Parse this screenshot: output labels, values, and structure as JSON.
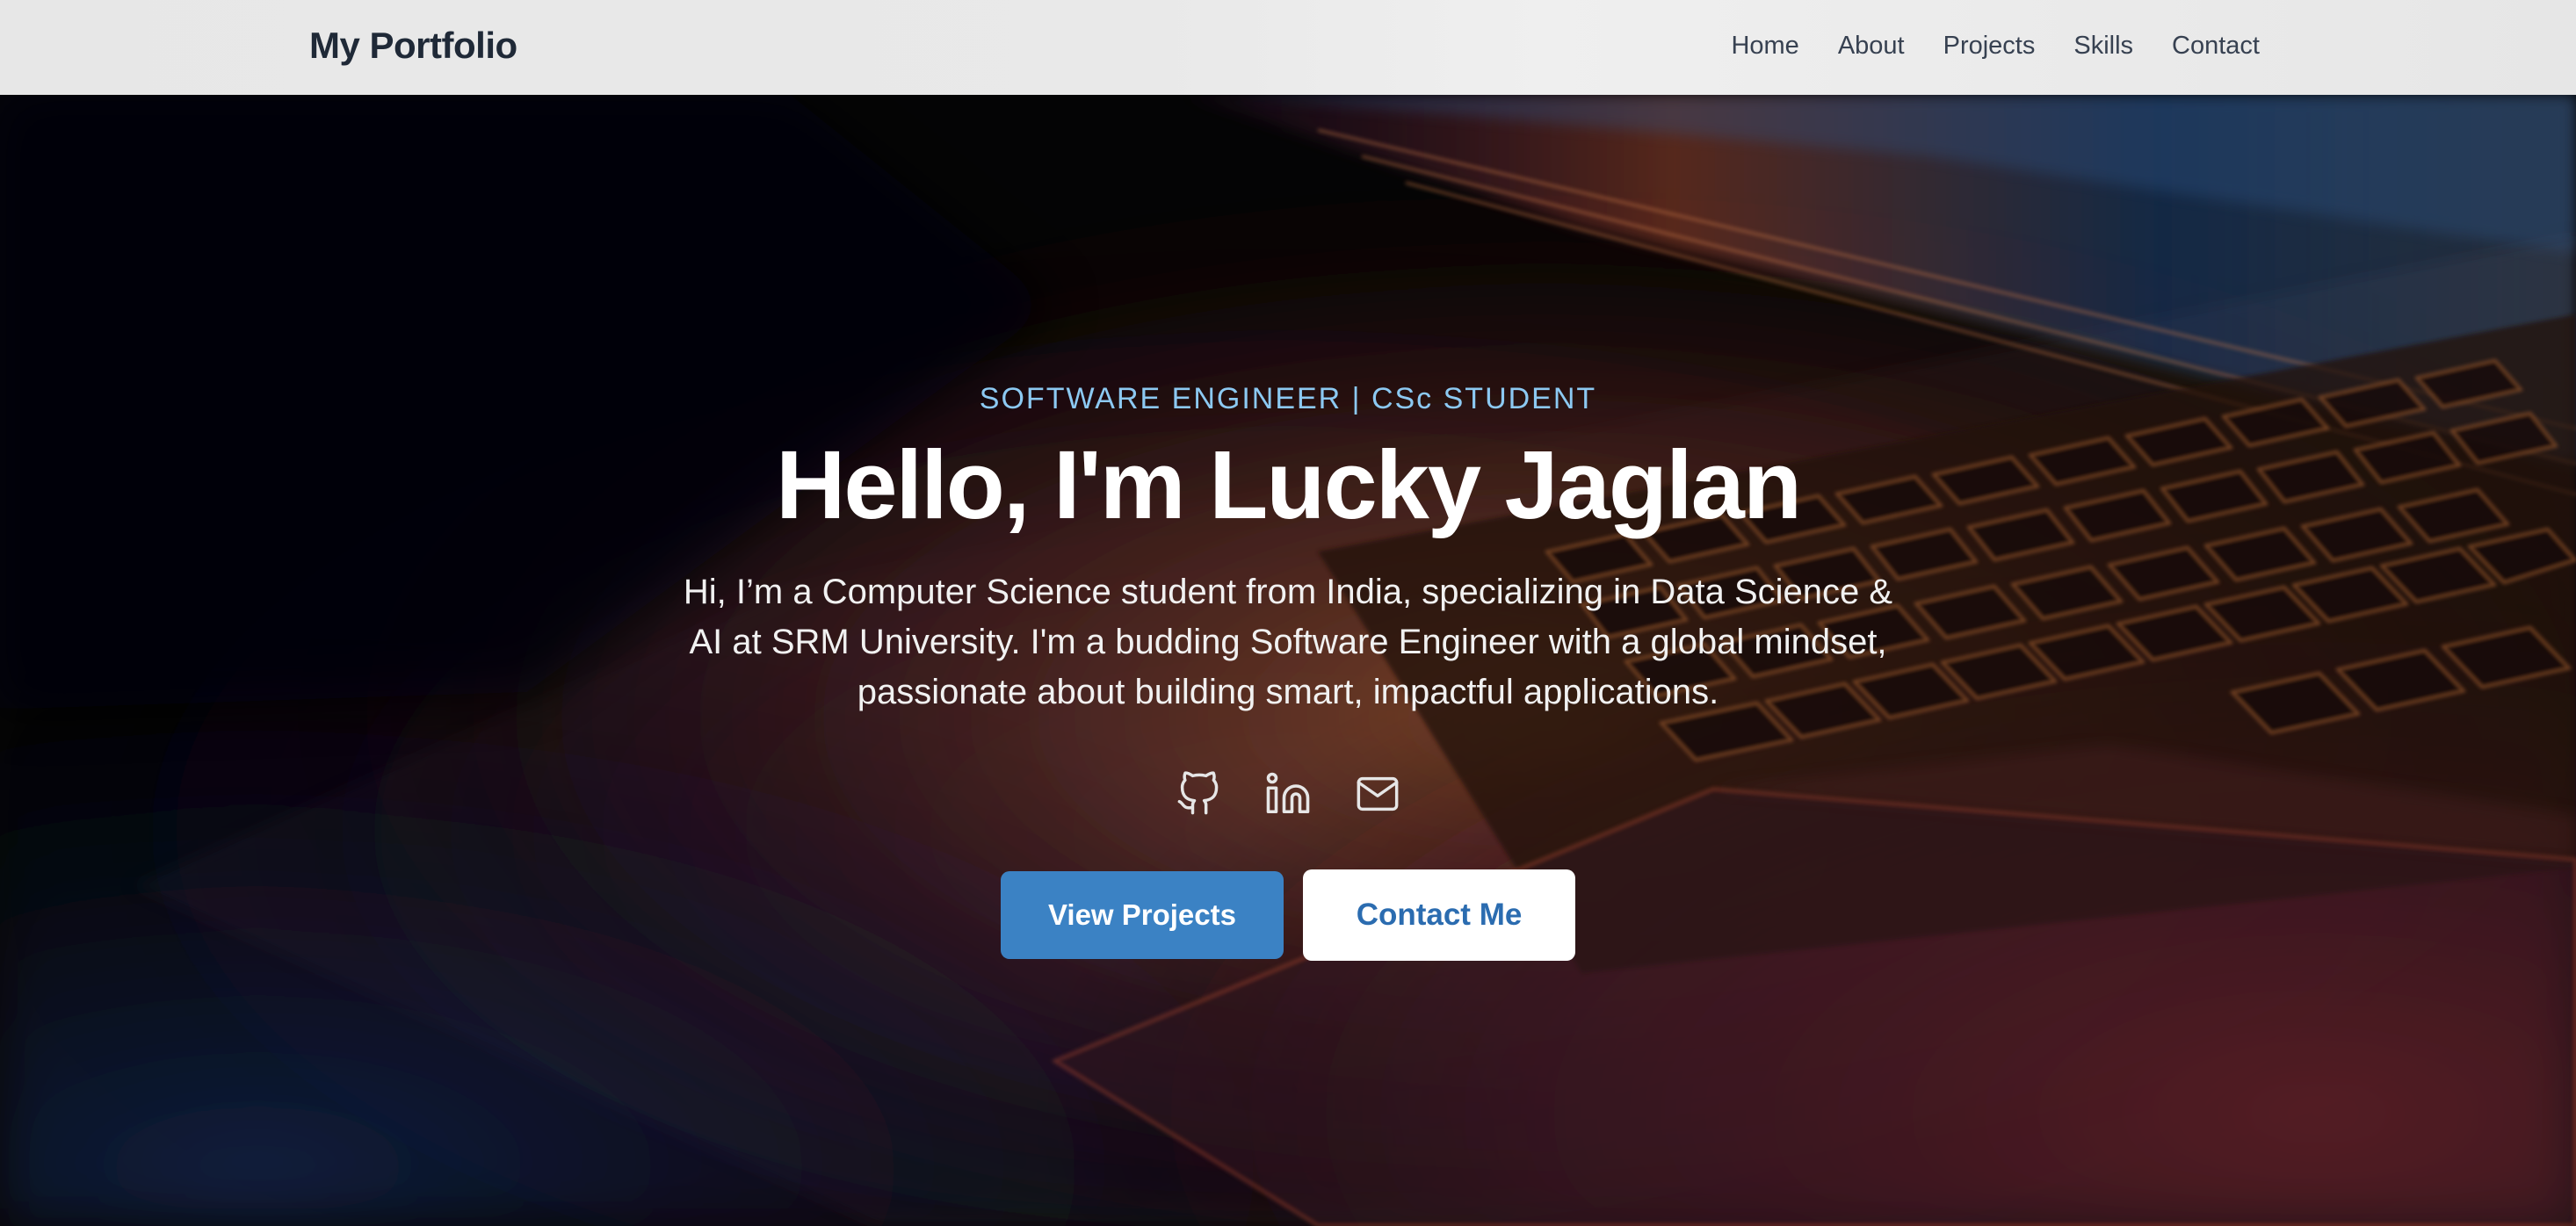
{
  "header": {
    "brand": "My Portfolio",
    "nav": [
      "Home",
      "About",
      "Projects",
      "Skills",
      "Contact"
    ]
  },
  "hero": {
    "tagline": "SOFTWARE ENGINEER | CSc STUDENT",
    "title": "Hello, I'm Lucky Jaglan",
    "description": "Hi, I’m a Computer Science student from India, specializing in Data Science & AI at SRM University. I'm a budding Software Engineer with a global mindset, passionate about building smart, impactful applications.",
    "socials": [
      {
        "icon": "github-icon"
      },
      {
        "icon": "linkedin-icon"
      },
      {
        "icon": "mail-icon"
      }
    ],
    "primary_button": "View Projects",
    "secondary_button": "Contact Me"
  },
  "colors": {
    "accent": "#3b82c4",
    "tagline": "#8cc9f2",
    "header_bg": "#e7e7e7",
    "brand_text": "#1f2937"
  }
}
